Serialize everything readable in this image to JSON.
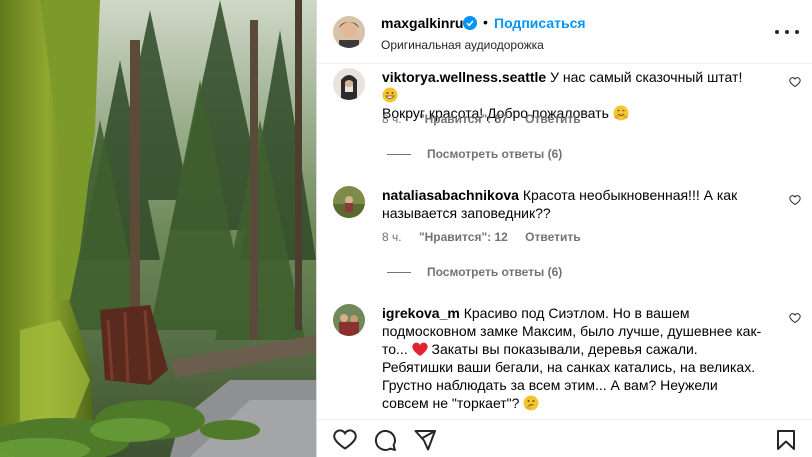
{
  "post": {
    "username": "maxgalkinru",
    "follow_label": "Подписаться",
    "separator": "•",
    "audio_label": "Оригинальная аудиодорожка"
  },
  "comments": [
    {
      "username": "viktorya.wellness.seattle",
      "text": "У нас самый сказочный штат!",
      "text2": "Вокруг красота! Добро пожаловать",
      "time": "8 ч.",
      "likes": "\"Нравится\": 57",
      "reply": "Ответить",
      "view_replies": "Посмотреть ответы (6)"
    },
    {
      "username": "nataliasabachnikova",
      "text": "Красота необыкновенная!!! А как называется заповедник??",
      "time": "8 ч.",
      "likes": "\"Нравится\": 12",
      "reply": "Ответить",
      "view_replies": "Посмотреть ответы (6)"
    },
    {
      "username": "igrekova_m",
      "text": "Красиво под Сиэтлом. Но в вашем подмосковном замке Максим, было лучше, душевнее как-то...",
      "text2": "Закаты вы показывали, деревья сажали. Ребятишки ваши бегали, на санках катались, на великах. Грустно наблюдать за всем этим... А вам? Неужели совсем не \"торкает\"?"
    }
  ],
  "icons": [
    "verified-icon",
    "more-icon",
    "heart-icon",
    "comment-icon",
    "share-icon",
    "bookmark-icon"
  ],
  "colors": {
    "accent": "#0095f6",
    "secondary_text": "#737373",
    "divider": "#dbdbdb"
  }
}
